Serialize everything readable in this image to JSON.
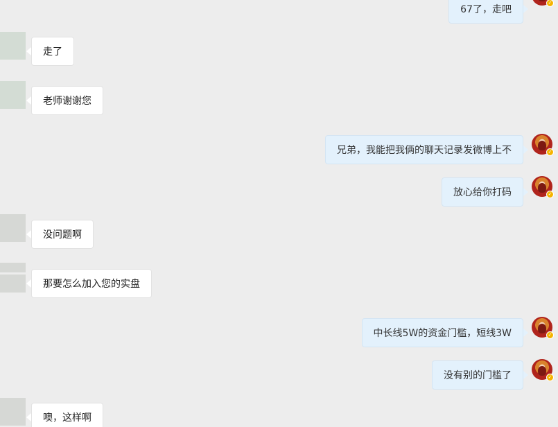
{
  "messages": [
    {
      "side": "out",
      "text": "67了，走吧"
    },
    {
      "side": "in",
      "text": "走了"
    },
    {
      "side": "in",
      "text": "老师谢谢您"
    },
    {
      "side": "out",
      "text": "兄弟，我能把我俩的聊天记录发微博上不"
    },
    {
      "side": "out",
      "text": "放心给你打码"
    },
    {
      "side": "in",
      "text": "没问题啊"
    },
    {
      "side": "in",
      "text": "那要怎么加入您的实盘"
    },
    {
      "side": "out",
      "text": "中长线5W的资金门槛，短线3W"
    },
    {
      "side": "out",
      "text": "没有别的门槛了"
    },
    {
      "side": "in",
      "text": "噢，这样啊"
    }
  ],
  "icons": {
    "verified_badge": "check-icon",
    "verified_badge_glyph": "✓",
    "verified_badge_color": "#f5b400"
  },
  "colors": {
    "background": "#ededed",
    "incoming_bubble": "#ffffff",
    "outgoing_bubble": "#e3f1fc"
  }
}
